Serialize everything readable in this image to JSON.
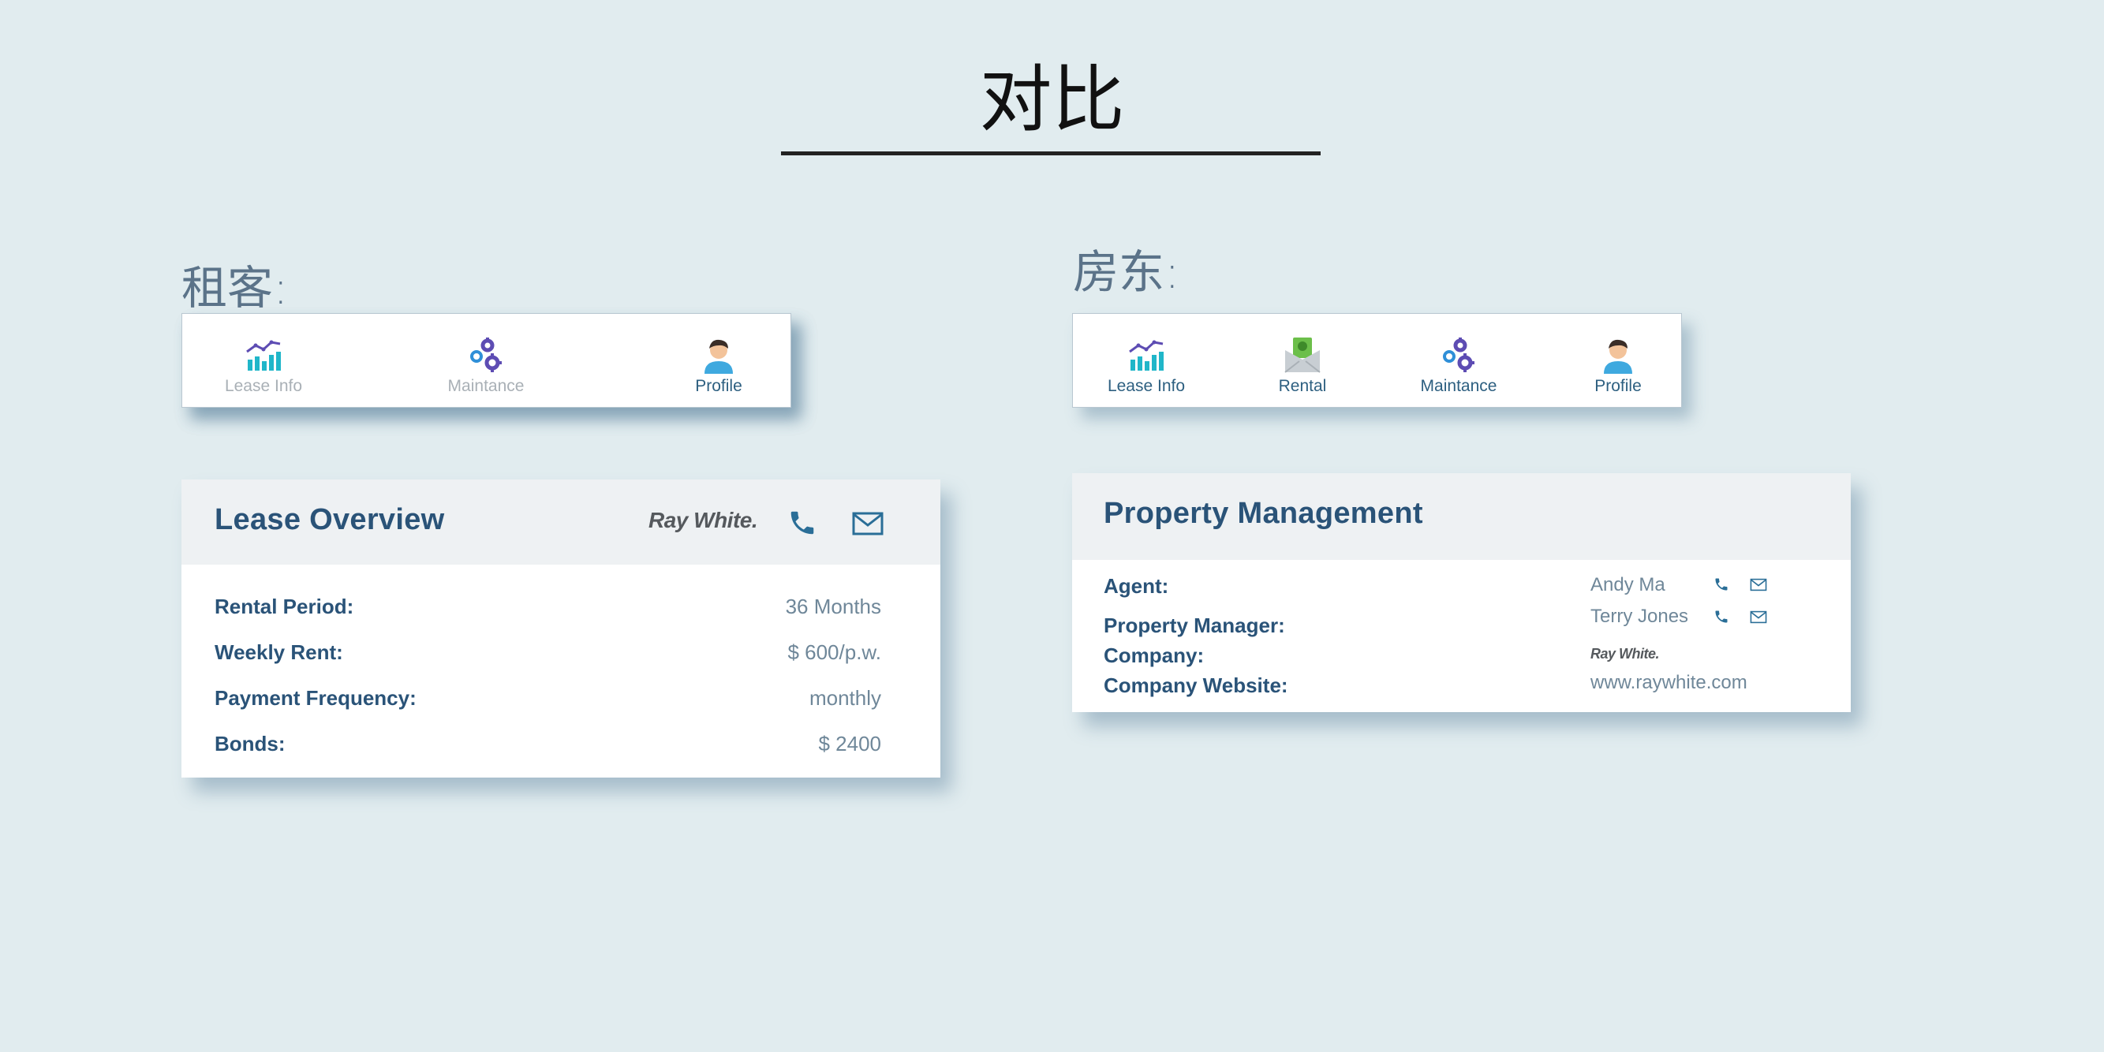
{
  "page": {
    "title": "对比"
  },
  "tenant": {
    "label": "租客:",
    "nav": [
      {
        "label": "Lease Info",
        "icon": "chart-icon",
        "state": "muted"
      },
      {
        "label": "Maintance",
        "icon": "gears-icon",
        "state": "muted"
      },
      {
        "label": "Profile",
        "icon": "person-icon",
        "state": "active"
      }
    ],
    "card": {
      "title": "Lease Overview",
      "brand": "Ray White",
      "brand_dot": ".",
      "rows": [
        {
          "label": "Rental Period:",
          "value": "36 Months"
        },
        {
          "label": "Weekly Rent:",
          "value": "$ 600/p.w."
        },
        {
          "label": "Payment Frequency:",
          "value": "monthly"
        },
        {
          "label": "Bonds:",
          "value": "$ 2400"
        }
      ]
    }
  },
  "landlord": {
    "label": "房东:",
    "nav": [
      {
        "label": "Lease Info",
        "icon": "chart-icon",
        "state": "active"
      },
      {
        "label": "Rental",
        "icon": "money-envelope-icon",
        "state": "active"
      },
      {
        "label": "Maintance",
        "icon": "gears-icon",
        "state": "active"
      },
      {
        "label": "Profile",
        "icon": "person-icon",
        "state": "active"
      }
    ],
    "card": {
      "title": "Property Management",
      "agent_label": "Agent:",
      "agent_value": "Andy Ma",
      "manager_label": "Property Manager:",
      "manager_value": "Terry Jones",
      "company_label": "Company:",
      "company_brand": "Ray White",
      "company_brand_dot": ".",
      "website_label": "Company Website:",
      "website_value": "www.raywhite.com"
    }
  },
  "colors": {
    "background": "#e1ecef",
    "accent": "#2a5378",
    "muted": "#a9b0b6",
    "icon_teal": "#20b6c9",
    "icon_purple": "#5d4cb3"
  }
}
